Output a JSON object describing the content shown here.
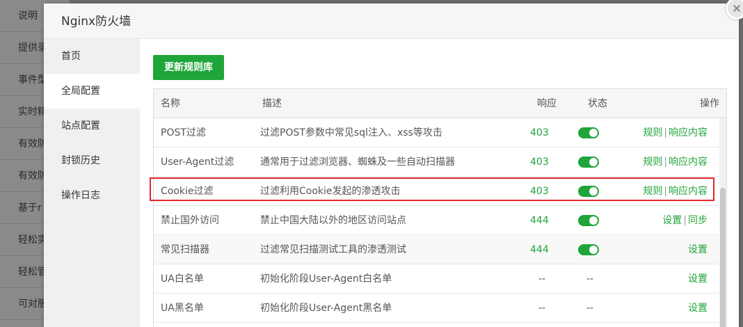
{
  "background_list": [
    "说明",
    "提供录",
    "事件型",
    "实时精",
    "有效防",
    "有效防",
    "基于r",
    "轻松实",
    "轻松管",
    "可对服"
  ],
  "dialog": {
    "title": "Nginx防火墙"
  },
  "sidebar": {
    "items": [
      {
        "label": "首页"
      },
      {
        "label": "全局配置",
        "active": true
      },
      {
        "label": "站点配置"
      },
      {
        "label": "封锁历史"
      },
      {
        "label": "操作日志"
      }
    ]
  },
  "toolbar": {
    "update_label": "更新规则库"
  },
  "table": {
    "headers": {
      "name": "名称",
      "desc": "描述",
      "code": "响应",
      "status": "状态",
      "ops": "操作"
    },
    "rows": [
      {
        "name": "POST过滤",
        "desc": "过滤POST参数中常见sql注入、xss等攻击",
        "code": "403",
        "status": "on",
        "op1": "规则",
        "sep": "|",
        "op2": "响应内容"
      },
      {
        "name": "User-Agent过滤",
        "desc": "通常用于过滤浏览器、蜘蛛及一些自动扫描器",
        "code": "403",
        "status": "on",
        "op1": "规则",
        "sep": "|",
        "op2": "响应内容"
      },
      {
        "name": "Cookie过滤",
        "desc": "过滤利用Cookie发起的渗透攻击",
        "code": "403",
        "status": "on",
        "op1": "规则",
        "sep": "|",
        "op2": "响应内容"
      },
      {
        "name": "禁止国外访问",
        "desc": "禁止中国大陆以外的地区访问站点",
        "code": "444",
        "status": "on",
        "op1": "设置",
        "sep": "|",
        "op2": "同步"
      },
      {
        "name": "常见扫描器",
        "desc": "过滤常见扫描测试工具的渗透测试",
        "code": "444",
        "status": "on",
        "op1": "设置"
      },
      {
        "name": "UA白名单",
        "desc": "初始化阶段User-Agent白名单",
        "code": "--",
        "status_text": "--",
        "op1": "设置"
      },
      {
        "name": "UA黑名单",
        "desc": "初始化阶段User-Agent黑名单",
        "code": "--",
        "status_text": "--",
        "op1": "设置"
      }
    ]
  },
  "colors": {
    "accent": "#20a53a",
    "highlight": "#e0262b"
  }
}
